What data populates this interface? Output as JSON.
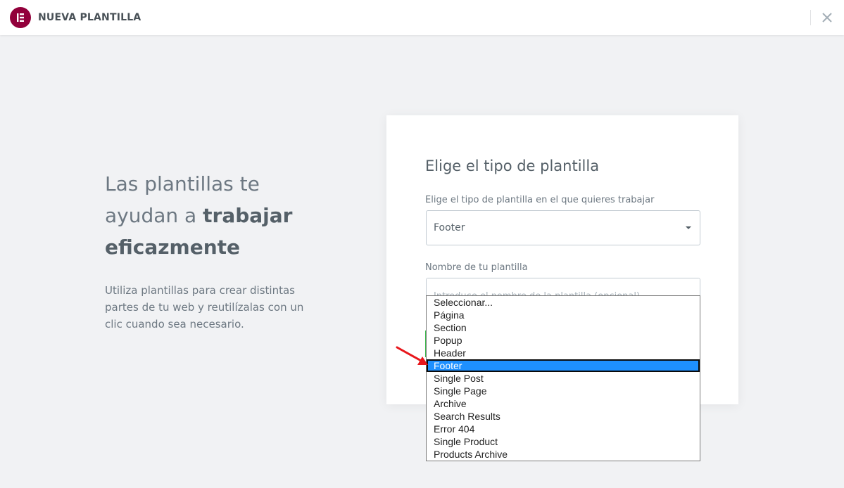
{
  "header": {
    "title": "NUEVA PLANTILLA"
  },
  "hero": {
    "title_line1": "Las plantillas te",
    "title_line2_prefix": "ayudan a ",
    "title_line2_bold": "trabajar",
    "title_line3_bold": "eficazmente",
    "description": "Utiliza plantillas para crear distintas partes de tu web y reutilízalas con un clic cuando sea necesario."
  },
  "form": {
    "title": "Elige el tipo de plantilla",
    "type_label": "Elige el tipo de plantilla en el que quieres trabajar",
    "type_value": "Footer",
    "name_label": "Nombre de tu plantilla",
    "name_placeholder": "Introduce el nombre de la plantilla (opcional)"
  },
  "dropdown": {
    "options": [
      {
        "label": "Seleccionar..."
      },
      {
        "label": "Página"
      },
      {
        "label": "Section"
      },
      {
        "label": "Popup"
      },
      {
        "label": "Header"
      },
      {
        "label": "Footer",
        "selected": true
      },
      {
        "label": "Single Post"
      },
      {
        "label": "Single Page"
      },
      {
        "label": "Archive"
      },
      {
        "label": "Search Results"
      },
      {
        "label": "Error 404"
      },
      {
        "label": "Single Product"
      },
      {
        "label": "Products Archive"
      }
    ]
  },
  "colors": {
    "brand": "#92003b",
    "selection": "#1e90ff",
    "annotation_arrow": "#e8161b",
    "accent_green": "#39b54a"
  },
  "icons": {
    "logo": "elementor-logo-icon",
    "close": "close-icon",
    "caret": "chevron-down-icon"
  }
}
